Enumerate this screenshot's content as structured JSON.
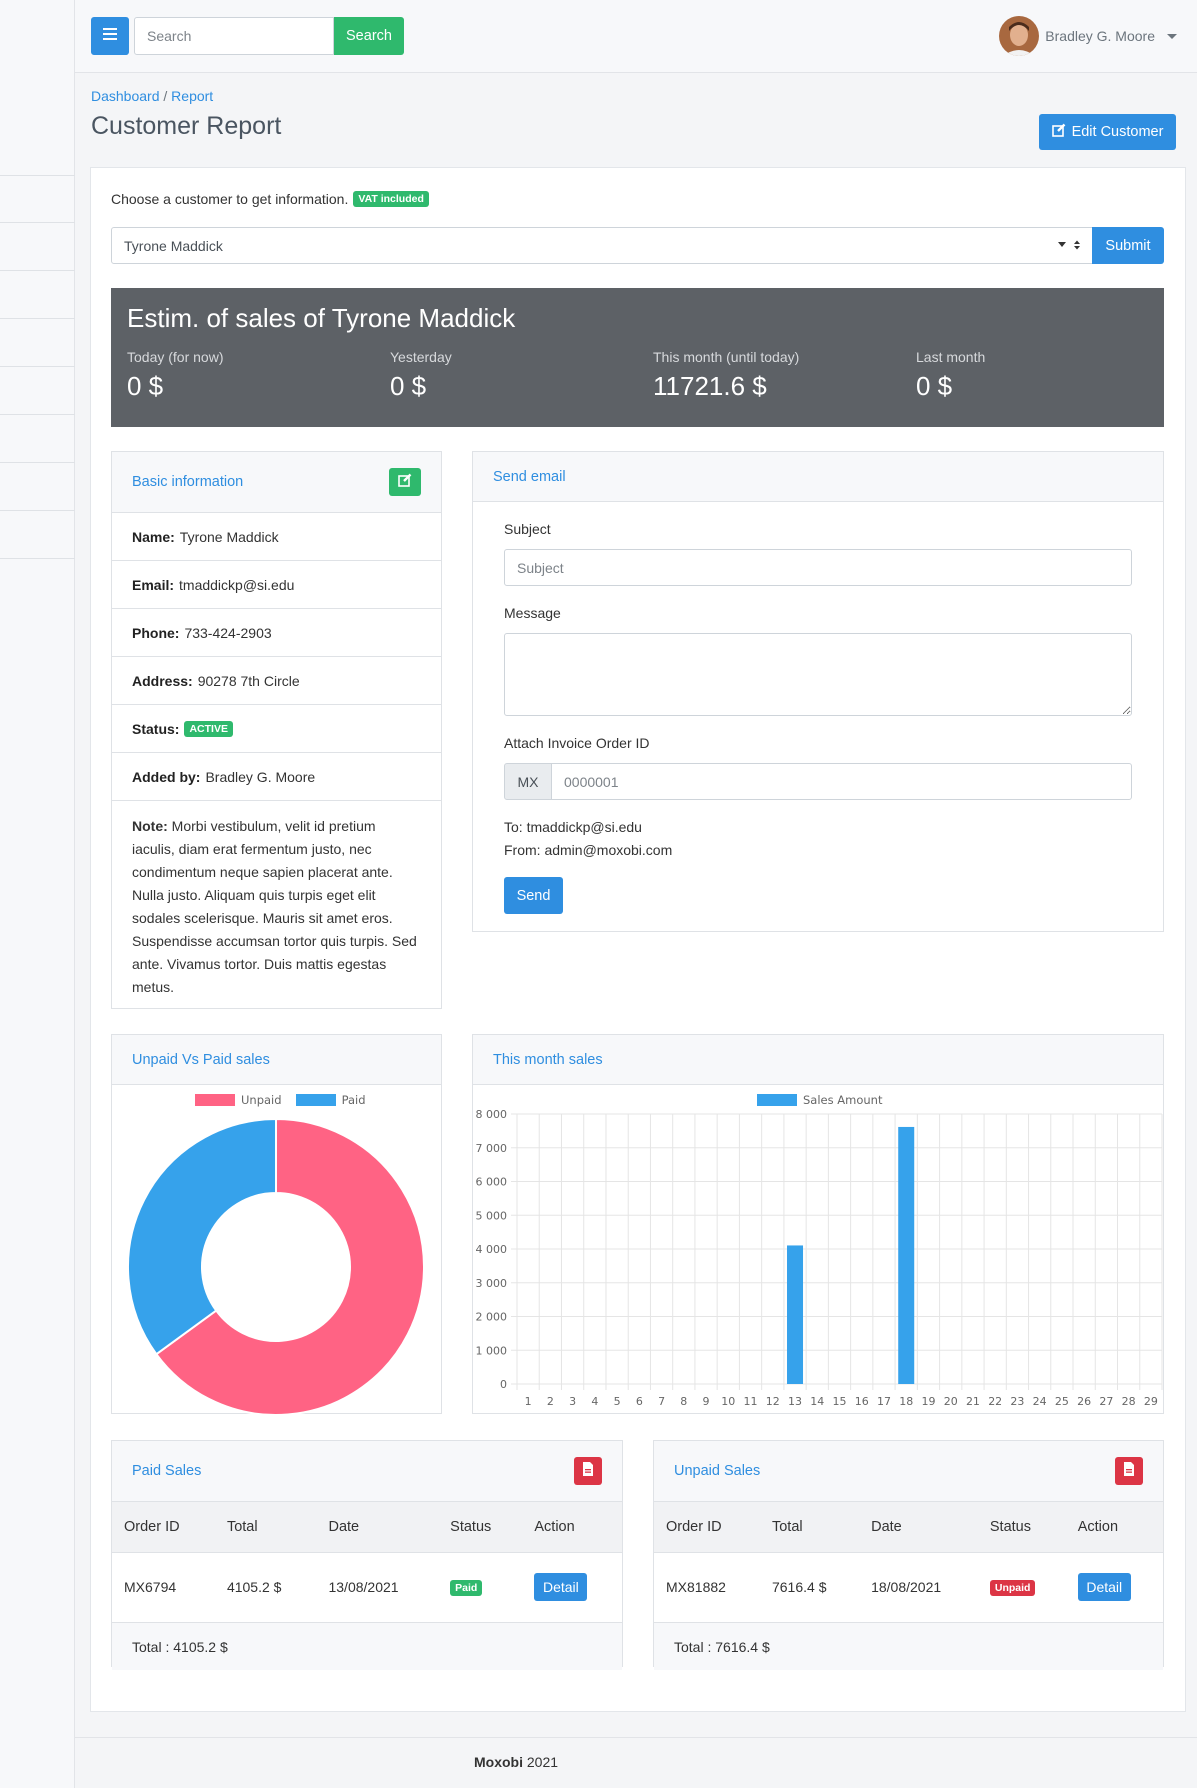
{
  "header": {
    "search_placeholder": "Search",
    "search_button": "Search",
    "user_name": "Bradley G. Moore"
  },
  "breadcrumb": {
    "home": "Dashboard",
    "separator": "/",
    "current": "Report"
  },
  "page": {
    "title": "Customer Report",
    "edit_button": "Edit Customer"
  },
  "customer_select": {
    "prompt": "Choose a customer to get information.",
    "vat_badge": "VAT included",
    "selected": "Tyrone Maddick",
    "submit": "Submit"
  },
  "stats": {
    "title": "Estim. of sales of Tyrone Maddick",
    "items": [
      {
        "label": "Today (for now)",
        "value": "0 $"
      },
      {
        "label": "Yesterday",
        "value": "0 $"
      },
      {
        "label": "This month (until today)",
        "value": "11721.6 $"
      },
      {
        "label": "Last month",
        "value": "0 $"
      }
    ]
  },
  "basic_info": {
    "title": "Basic information",
    "name_label": "Name:",
    "name": "Tyrone Maddick",
    "email_label": "Email:",
    "email": "tmaddickp@si.edu",
    "phone_label": "Phone:",
    "phone": "733-424-2903",
    "address_label": "Address:",
    "address": "90278 7th Circle",
    "status_label": "Status:",
    "status": "ACTIVE",
    "added_label": "Added by:",
    "added_by": "Bradley G. Moore",
    "note_label": "Note:",
    "note": "Morbi vestibulum, velit id pretium iaculis, diam erat fermentum justo, nec condimentum neque sapien placerat ante. Nulla justo. Aliquam quis turpis eget elit sodales scelerisque. Mauris sit amet eros. Suspendisse accumsan tortor quis turpis. Sed ante. Vivamus tortor. Duis mattis egestas metus."
  },
  "send_email": {
    "title": "Send email",
    "subject_label": "Subject",
    "subject_placeholder": "Subject",
    "message_label": "Message",
    "attach_label": "Attach Invoice Order ID",
    "prefix": "MX",
    "order_placeholder": "0000001",
    "to": "To: tmaddickp@si.edu",
    "from": "From: admin@moxobi.com",
    "send_button": "Send"
  },
  "colors": {
    "primary": "#2f8ee0",
    "success": "#2fb96d",
    "danger": "#dc3545",
    "unpaid": "#ff6384",
    "paid": "#36a2eb",
    "stats_bg": "#5d6166"
  },
  "chart_data": [
    {
      "type": "pie",
      "title": "Unpaid Vs Paid sales",
      "donut": true,
      "legend": "top",
      "categories": [
        "Unpaid",
        "Paid"
      ],
      "values": [
        7616.4,
        4105.2
      ],
      "colors": [
        "#ff6384",
        "#36a2eb"
      ]
    },
    {
      "type": "bar",
      "title": "This month sales",
      "legend": "top",
      "series": [
        {
          "name": "Sales Amount",
          "color": "#36a2eb",
          "values": [
            0,
            0,
            0,
            0,
            0,
            0,
            0,
            0,
            0,
            0,
            0,
            0,
            4105.2,
            0,
            0,
            0,
            0,
            7616.4,
            0,
            0,
            0,
            0,
            0,
            0,
            0,
            0,
            0,
            0,
            0
          ]
        }
      ],
      "categories": [
        "1",
        "2",
        "3",
        "4",
        "5",
        "6",
        "7",
        "8",
        "9",
        "10",
        "11",
        "12",
        "13",
        "14",
        "15",
        "16",
        "17",
        "18",
        "19",
        "20",
        "21",
        "22",
        "23",
        "24",
        "25",
        "26",
        "27",
        "28",
        "29"
      ],
      "ylim": [
        0,
        8000
      ],
      "yticks": [
        "0",
        "1 000",
        "2 000",
        "3 000",
        "4 000",
        "5 000",
        "6 000",
        "7 000",
        "8 000"
      ],
      "grid": true
    }
  ],
  "paid_sales": {
    "title": "Paid Sales",
    "columns": [
      "Order ID",
      "Total",
      "Date",
      "Status",
      "Action"
    ],
    "rows": [
      {
        "id": "MX6794",
        "total": "4105.2 $",
        "date": "13/08/2021",
        "status": "Paid",
        "action": "Detail"
      }
    ],
    "footer": "Total : 4105.2 $"
  },
  "unpaid_sales": {
    "title": "Unpaid Sales",
    "columns": [
      "Order ID",
      "Total",
      "Date",
      "Status",
      "Action"
    ],
    "rows": [
      {
        "id": "MX81882",
        "total": "7616.4 $",
        "date": "18/08/2021",
        "status": "Unpaid",
        "action": "Detail"
      }
    ],
    "footer": "Total : 7616.4 $"
  },
  "footer": {
    "brand": "Moxobi",
    "year": "2021"
  }
}
